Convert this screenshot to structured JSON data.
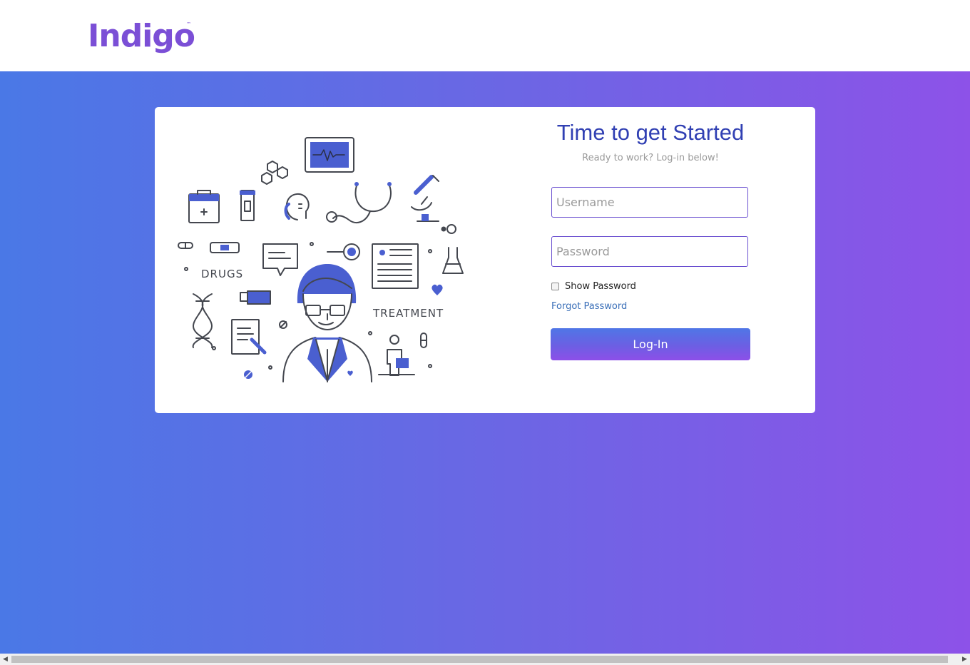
{
  "brand": {
    "name": "Indigo",
    "tm": "™"
  },
  "illustration": {
    "labels": {
      "drugs": "DRUGS",
      "treatment": "TREATMENT"
    }
  },
  "login": {
    "title": "Time to get Started",
    "subtitle": "Ready to work? Log-in below!",
    "username_placeholder": "Username",
    "password_placeholder": "Password",
    "show_password_label": "Show Password",
    "forgot_password_label": "Forgot Password",
    "login_button_label": "Log-In"
  },
  "colors": {
    "brand": "#7b4fd6",
    "title": "#3140b3",
    "gradient_start": "#4a78e6",
    "gradient_end": "#8d52e8",
    "link": "#3a6fb8",
    "illustration_accent": "#4a5fd0"
  },
  "scrollbar": {
    "left_arrow": "◀",
    "right_arrow": "▶"
  }
}
